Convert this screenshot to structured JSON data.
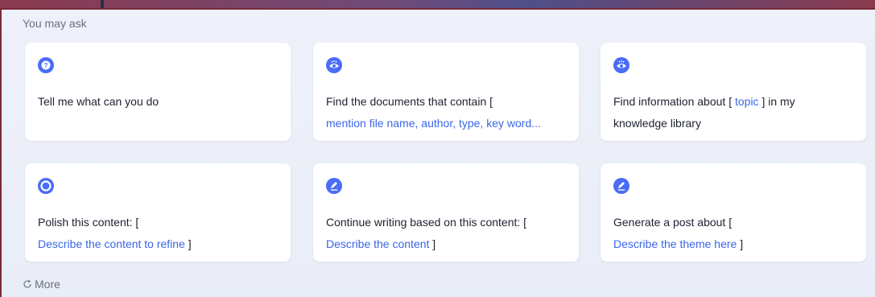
{
  "header": {
    "title": "You may ask"
  },
  "cards": [
    {
      "icon": "question-icon",
      "text": "Tell me what can you do"
    },
    {
      "icon": "eye-search-icon",
      "text": "Find the documents that contain [",
      "hint": "mention file name, author, type, key word..."
    },
    {
      "icon": "eye-search-icon",
      "text": "Find information about [",
      "hint": "topic",
      "suffix": "] in my knowledge library"
    },
    {
      "icon": "chat-bubble-icon",
      "text": "Polish this content: [",
      "hint": "Describe the content to refine",
      "suffix": "]"
    },
    {
      "icon": "pen-icon",
      "text": "Continue writing based on this content: [",
      "hint": "Describe the content",
      "suffix": "]"
    },
    {
      "icon": "pen-icon",
      "text": "Generate a post about [",
      "hint": "Describe the theme here",
      "suffix": "]"
    }
  ],
  "more": {
    "label": "More",
    "icon": "refresh-icon"
  },
  "colors": {
    "accent": "#3b66e8",
    "icon_bg": "#4a6cf7"
  }
}
